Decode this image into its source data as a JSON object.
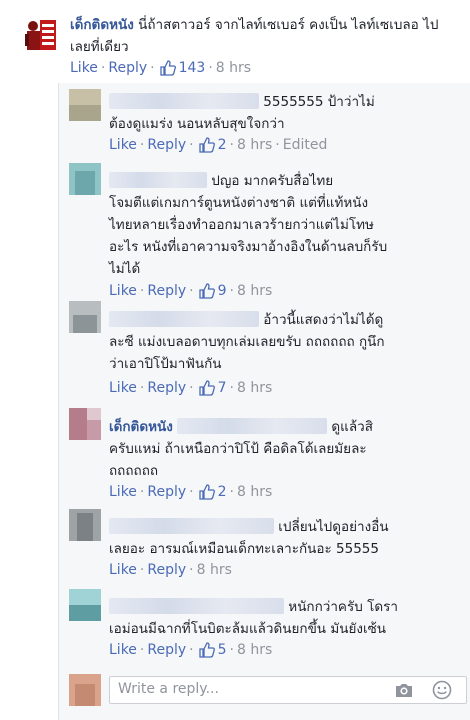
{
  "main_comment": {
    "author": "เด็กติดหนัง",
    "text": "นี่ถ้าสตาวอร์ จากไลท์เซเบอร์ คงเป็น ไลท์เซเบลอ ไปเลยที่เดียว",
    "like_label": "Like",
    "reply_label": "Reply",
    "likes": "143",
    "time": "8 hrs"
  },
  "replies": [
    {
      "line1": "5555555 ป้าว่าไม่",
      "line2": "ต้องดูแมร่ง นอนหลับสุขใจกว่า",
      "like_label": "Like",
      "reply_label": "Reply",
      "likes": "2",
      "time": "8 hrs",
      "edited": "Edited"
    },
    {
      "line1": "ปญอ มากครับสื่อไทย",
      "line2": "โจมตีแต่เกมการ์ตูนหนังต่างชาติ แต่ที่แท้หนัง",
      "line3": "ไทยหลายเรื่องทำออกมาเลวร้ายกว่าแต่ไม่โทษ",
      "line4": "อะไร หนังที่เอาความจริงมาอ้างอิงในด้านลบก็รับ",
      "line5": "ไม่ได้",
      "like_label": "Like",
      "reply_label": "Reply",
      "likes": "9",
      "time": "8 hrs"
    },
    {
      "line1": "อ้าวนี้แสดงว่าไม่ได้ดู",
      "line2": "ละซี แม่งเบลอดาบทุกเล่มเลยขรับ ถถถถถถ กูนึก",
      "line3": "ว่าเอาปิโป้มาฟันกัน",
      "like_label": "Like",
      "reply_label": "Reply",
      "likes": "7",
      "time": "8 hrs"
    },
    {
      "author": "เด็กติดหนัง",
      "line1": "ดูแล้วสิ",
      "line2": "ครับแหม่ ถ้าเหนือกว่าปิโป้ คือดิลโด้เลยมัยละ",
      "line3": "ถถถถถถ",
      "like_label": "Like",
      "reply_label": "Reply",
      "likes": "2",
      "time": "8 hrs"
    },
    {
      "line1": "เปลี่ยนไปดูอย่างอื่น",
      "line2": "เลยอะ อารมณ์เหมือนเด็กทะเลาะกันอะ 55555",
      "like_label": "Like",
      "reply_label": "Reply",
      "time": "8 hrs"
    },
    {
      "line1": "หนักกว่าครับ โดรา",
      "line2": "เอม่อนมีฉากที่โนบิตะล้มแล้วดินยกขึ้น มันยังเซ้น",
      "like_label": "Like",
      "reply_label": "Reply",
      "likes": "5",
      "time": "8 hrs"
    }
  ],
  "write_reply": {
    "placeholder": "Write a reply..."
  },
  "colors": {
    "link": "#4b6bb7",
    "name": "#365899",
    "meta": "#90949c",
    "reply_bg": "#f6f7f9"
  }
}
